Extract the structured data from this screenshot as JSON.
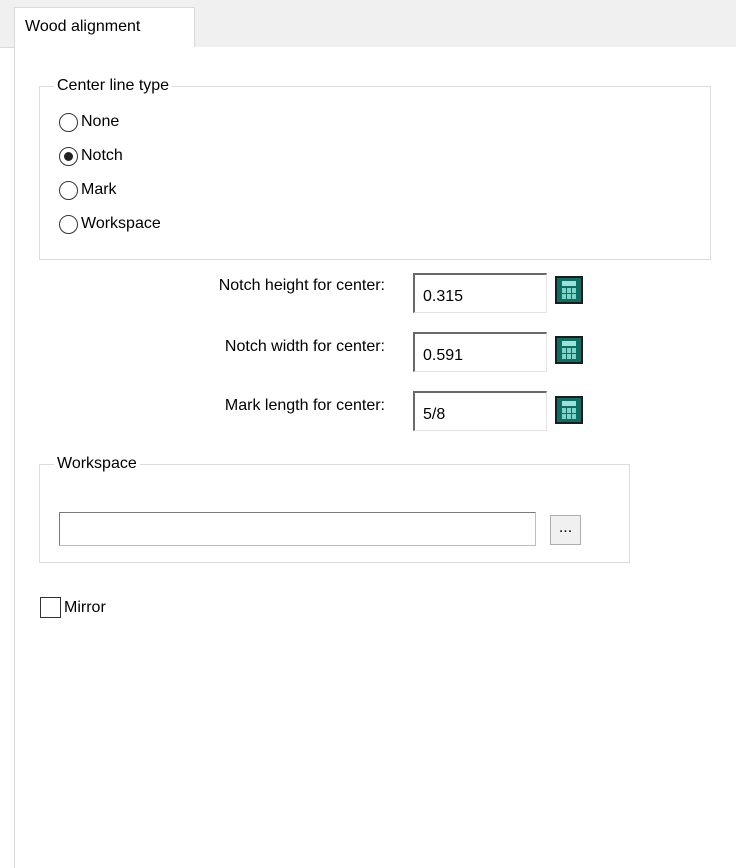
{
  "tabs": [
    {
      "label": "Wood alignment",
      "active": true
    }
  ],
  "center_line_type": {
    "legend": "Center line type",
    "options": [
      {
        "label": "None",
        "selected": false
      },
      {
        "label": "Notch",
        "selected": true
      },
      {
        "label": "Mark",
        "selected": false
      },
      {
        "label": "Workspace",
        "selected": false
      }
    ]
  },
  "fields": {
    "notch_height": {
      "label": "Notch height for center:",
      "value": "0.315"
    },
    "notch_width": {
      "label": "Notch width for center:",
      "value": "0.591"
    },
    "mark_length": {
      "label": "Mark length for center:",
      "value": "5/8"
    }
  },
  "workspace": {
    "legend": "Workspace",
    "path_value": "",
    "browse_label": "..."
  },
  "mirror": {
    "label": "Mirror",
    "checked": false
  },
  "icons": {
    "calculator": "calculator-icon"
  },
  "colors": {
    "calculator_body": "#0f6e64",
    "tab_strip": "#f0f0f0"
  }
}
